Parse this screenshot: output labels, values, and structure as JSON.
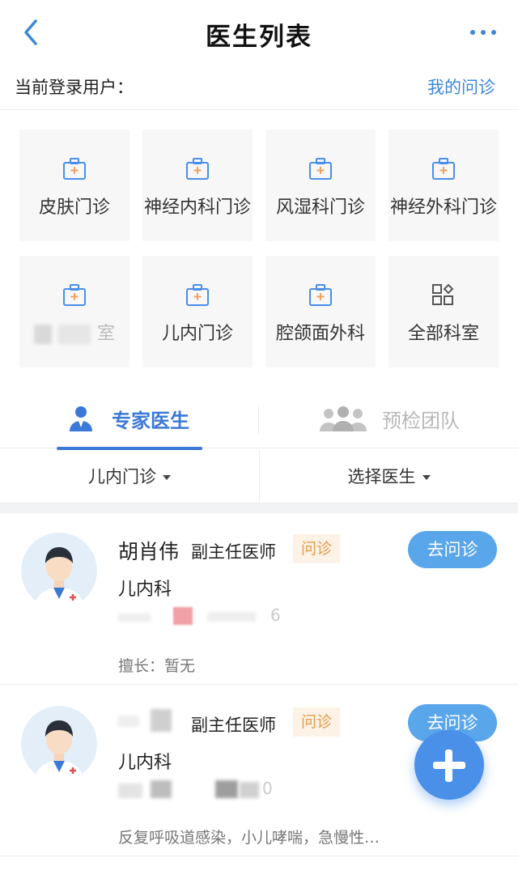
{
  "nav": {
    "title": "医生列表"
  },
  "user": {
    "label": "当前登录用户：",
    "my_consult": "我的问诊"
  },
  "departments": [
    {
      "label": "皮肤门诊",
      "icon": "medical-kit-icon"
    },
    {
      "label": "神经内科门诊",
      "icon": "medical-kit-icon"
    },
    {
      "label": "风湿科门诊",
      "icon": "medical-kit-icon"
    },
    {
      "label": "神经外科门诊",
      "icon": "medical-kit-icon"
    },
    {
      "label": "室",
      "icon": "medical-kit-icon"
    },
    {
      "label": "儿内门诊",
      "icon": "medical-kit-icon"
    },
    {
      "label": "腔颌面外科",
      "icon": "medical-kit-icon"
    },
    {
      "label": "全部科室",
      "icon": "grid-apps-icon"
    }
  ],
  "tabs": [
    {
      "label": "专家医生",
      "active": true
    },
    {
      "label": "预检团队",
      "active": false
    }
  ],
  "filters": {
    "department": "儿内门诊",
    "doctor": "选择医生"
  },
  "doctors": [
    {
      "name": "胡肖伟",
      "title": "副主任医师",
      "badge": "问诊",
      "dept": "儿内科",
      "skill": "擅长：暂无",
      "button": "去问诊",
      "partial_text": "6"
    },
    {
      "name": "",
      "title": "副主任医师",
      "badge": "问诊",
      "dept": "儿内科",
      "skill": "反复呼吸道感染，小儿哮喘，急慢性…",
      "button": "去问诊",
      "partial_text": "0"
    }
  ],
  "colors": {
    "accent": "#3b78d8",
    "button": "#5aa6ea",
    "badge_bg": "#fdf2e6",
    "badge_text": "#e89a4b"
  }
}
